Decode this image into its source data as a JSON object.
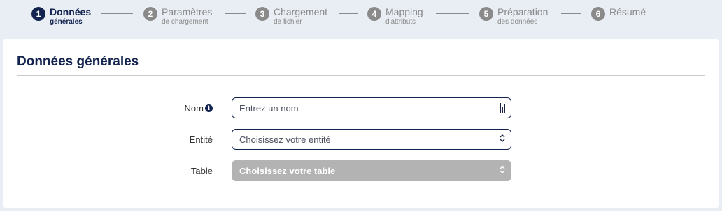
{
  "stepper": {
    "steps": [
      {
        "number": "1",
        "title": "Données",
        "subtitle": "générales"
      },
      {
        "number": "2",
        "title": "Paramètres",
        "subtitle": "de chargement"
      },
      {
        "number": "3",
        "title": "Chargement",
        "subtitle": "de fichier"
      },
      {
        "number": "4",
        "title": "Mapping",
        "subtitle": "d'attributs"
      },
      {
        "number": "5",
        "title": "Préparation",
        "subtitle": "des données"
      },
      {
        "number": "6",
        "title": "Résumé",
        "subtitle": ""
      }
    ],
    "active_step": "1"
  },
  "card": {
    "title": "Données générales"
  },
  "form": {
    "nom": {
      "label": "Nom",
      "info_icon": "i",
      "placeholder": "Entrez un nom",
      "icon": "password-manager-icon"
    },
    "entite": {
      "label": "Entité",
      "placeholder": "Choisissez votre entité",
      "icon": "chevron-updown-icon"
    },
    "table": {
      "label": "Table",
      "placeholder": "Choisissez votre table",
      "icon": "chevron-updown-icon",
      "disabled": true
    }
  },
  "colors": {
    "primary": "#13234f",
    "inactive": "#8a8a8a",
    "background": "#e9eef5",
    "disabled": "#b3b3b3"
  }
}
